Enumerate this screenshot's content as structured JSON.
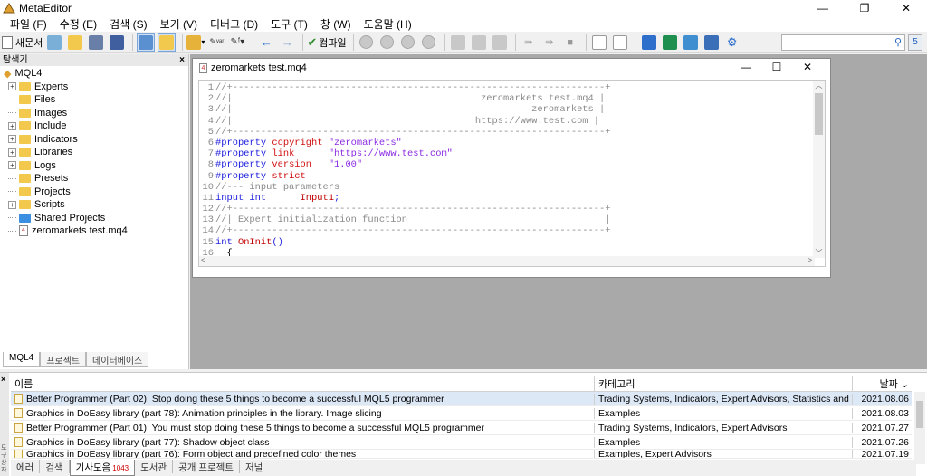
{
  "window": {
    "title": "MetaEditor",
    "minimize": "—",
    "maximize": "❐",
    "close": "✕"
  },
  "menu": [
    "파일 (F)",
    "수정 (E)",
    "검색 (S)",
    "보기 (V)",
    "디버그 (D)",
    "도구 (T)",
    "창 (W)",
    "도움말 (H)"
  ],
  "toolbar": {
    "new_label": "새문서",
    "compile_label": "컴파일",
    "search_placeholder": "",
    "community_badge": "5"
  },
  "navigator": {
    "title": "탐색기",
    "close": "×",
    "root": "MQL4",
    "items": [
      {
        "label": "Experts",
        "expandable": true
      },
      {
        "label": "Files",
        "expandable": false
      },
      {
        "label": "Images",
        "expandable": false
      },
      {
        "label": "Include",
        "expandable": true
      },
      {
        "label": "Indicators",
        "expandable": true
      },
      {
        "label": "Libraries",
        "expandable": true
      },
      {
        "label": "Logs",
        "expandable": true
      },
      {
        "label": "Presets",
        "expandable": false
      },
      {
        "label": "Projects",
        "expandable": false
      },
      {
        "label": "Scripts",
        "expandable": true
      },
      {
        "label": "Shared Projects",
        "expandable": false
      },
      {
        "label": "zeromarkets test.mq4",
        "expandable": false
      }
    ],
    "tabs": [
      "MQL4",
      "프로젝트",
      "데이터베이스"
    ]
  },
  "editor": {
    "file_title": "zeromarkets test.mq4",
    "lines": [
      {
        "n": "1",
        "t": "//+------------------------------------------------------------------+"
      },
      {
        "n": "2",
        "t": "//|                                            zeromarkets test.mq4 |"
      },
      {
        "n": "3",
        "t": "//|                                                     zeromarkets |"
      },
      {
        "n": "4",
        "t": "//|                                           https://www.test.com |"
      },
      {
        "n": "5",
        "t": "//+------------------------------------------------------------------+"
      },
      {
        "n": "6",
        "t": "#property copyright \"zeromarkets\""
      },
      {
        "n": "7",
        "t": "#property link      \"https://www.test.com\""
      },
      {
        "n": "8",
        "t": "#property version   \"1.00\""
      },
      {
        "n": "9",
        "t": "#property strict"
      },
      {
        "n": "10",
        "t": "//--- input parameters"
      },
      {
        "n": "11",
        "t": "input int      Input1;"
      },
      {
        "n": "12",
        "t": "//+------------------------------------------------------------------+"
      },
      {
        "n": "13",
        "t": "//| Expert initialization function                                   |"
      },
      {
        "n": "14",
        "t": "//+------------------------------------------------------------------+"
      },
      {
        "n": "15",
        "t": "int OnInit()"
      },
      {
        "n": "16",
        "t": "  {"
      }
    ]
  },
  "toolbox": {
    "close": "×",
    "side_label": "도구상자",
    "columns": {
      "name": "이름",
      "category": "카테고리",
      "date": "날짜"
    },
    "rows": [
      {
        "name": "Better Programmer (Part 02): Stop doing these 5 things to become a successful MQL5 programmer",
        "category": "Trading Systems, Indicators, Expert Advisors, Statistics and anal...",
        "date": "2021.08.06"
      },
      {
        "name": "Graphics in DoEasy library (part 78): Animation principles in the library. Image slicing",
        "category": "Examples",
        "date": "2021.08.03"
      },
      {
        "name": "Better Programmer (Part 01): You must stop doing these 5 things to become a successful MQL5 programmer",
        "category": "Trading Systems, Indicators, Expert Advisors",
        "date": "2021.07.27"
      },
      {
        "name": "Graphics in DoEasy library (part 77): Shadow object class",
        "category": "Examples",
        "date": "2021.07.26"
      },
      {
        "name": "Graphics in DoEasy library (part 76): Form object and predefined color themes",
        "category": "Examples, Expert Advisors",
        "date": "2021.07.19"
      }
    ],
    "tabs": [
      {
        "label": "에러",
        "badge": ""
      },
      {
        "label": "검색",
        "badge": ""
      },
      {
        "label": "기사모음",
        "badge": "1043"
      },
      {
        "label": "도서관",
        "badge": ""
      },
      {
        "label": "공개 프로젝트",
        "badge": ""
      },
      {
        "label": "저널",
        "badge": ""
      }
    ]
  }
}
